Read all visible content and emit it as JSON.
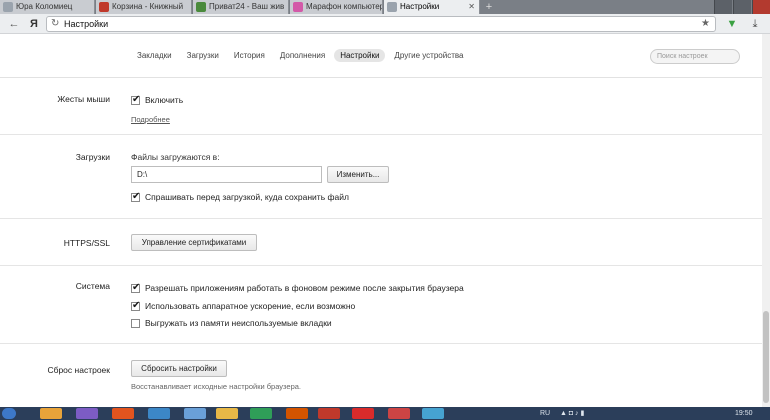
{
  "tabs": [
    {
      "title": "Юра Коломиец",
      "fav_color": "#9aa3ad",
      "active": false
    },
    {
      "title": "Корзина - Книжный",
      "fav_color": "#c0392b",
      "active": false
    },
    {
      "title": "Приват24 - Ваш жив",
      "fav_color": "#4a8a3c",
      "active": false
    },
    {
      "title": "Марафон компьютер",
      "fav_color": "#d35aa8",
      "active": false
    },
    {
      "title": "Настройки",
      "fav_color": "#9aa3ad",
      "active": true
    }
  ],
  "address": {
    "prefix": "Я",
    "url": "Настройки"
  },
  "menu": {
    "items": [
      "Закладки",
      "Загрузки",
      "История",
      "Дополнения",
      "Настройки",
      "Другие устройства"
    ],
    "active_index": 4,
    "search_placeholder": "Поиск настроек"
  },
  "mouse_gestures": {
    "label": "Жесты мыши",
    "enable": {
      "text": "Включить",
      "checked": true
    },
    "more_link": "Подробнее"
  },
  "downloads": {
    "label": "Загрузки",
    "caption": "Файлы загружаются в:",
    "path": "D:\\",
    "change_button": "Изменить...",
    "ask_before": {
      "text": "Спрашивать перед загрузкой, куда сохранить файл",
      "checked": true
    }
  },
  "https": {
    "label": "HTTPS/SSL",
    "button": "Управление сертификатами"
  },
  "system": {
    "label": "Система",
    "options": [
      {
        "text": "Разрешать приложениям работать в фоновом режиме после закрытия браузера",
        "checked": true
      },
      {
        "text": "Использовать аппаратное ускорение, если возможно",
        "checked": true
      },
      {
        "text": "Выгружать из памяти неиспользуемые вкладки",
        "checked": false
      }
    ]
  },
  "reset": {
    "label": "Сброс настроек",
    "button": "Сбросить настройки",
    "note": "Восстанавливает исходные настройки браузера."
  },
  "taskbar": {
    "lang": "RU",
    "time": "19:50",
    "app_colors": [
      "#3d78c8",
      "#e8a33a",
      "#7c5cc4",
      "#e2541f",
      "#3c87c7",
      "#6aa0d8",
      "#e7b847",
      "#2f9e58",
      "#d35400",
      "#c0392b",
      "#d92b2b",
      "#46a3d1"
    ]
  }
}
